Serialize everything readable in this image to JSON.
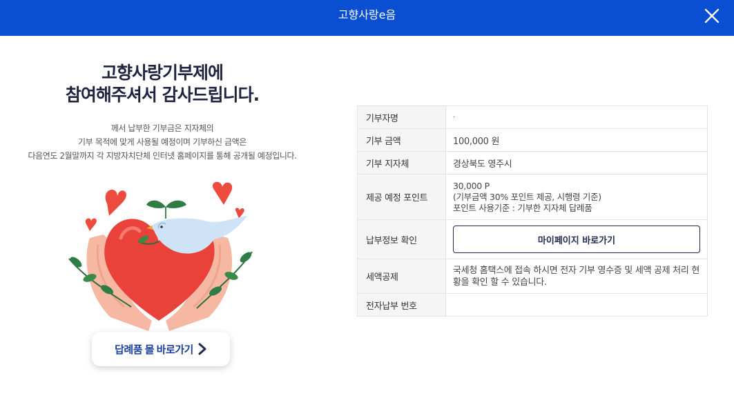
{
  "header": {
    "title": "고향사랑e음"
  },
  "heading": {
    "line1": "고향사랑기부제에",
    "line2": "참여해주셔서 감사드립니다."
  },
  "description": {
    "line1": "께서 납부한 기부금은 지자체의",
    "line2": "기부 목적에 맞게 사용될 예정이며 기부하신 금액은",
    "line3": "다음연도 2월말까지 각 지방자치단체 인터넷 홈페이지를 통해 공개될 예정입니다."
  },
  "mall_button": {
    "label": "답례품 몰 바로가기"
  },
  "details": {
    "donor_label": "기부자명",
    "donor_value": "·",
    "amount_label": "기부 금액",
    "amount_value": "100,000 원",
    "region_label": "기부 지자체",
    "region_value": "경상북도 영주시",
    "points_label": "제공 예정 포인트",
    "points_line1": "30,000 P",
    "points_line2": "(기부금액 30% 포인트 제공, 시행령 기준)",
    "points_line3": "포인트 사용기준 : 기부한 지자체 답례품",
    "payment_label": "납부정보 확인",
    "mypage_button": "마이페이지 바로가기",
    "tax_label": "세액공제",
    "tax_value": "국세청 홈택스에 접속 하시면 전자 기부 영수증 및 세액 공제 처리 현황을 확인 할 수 있습니다.",
    "epay_label": "전자납부 번호",
    "epay_value": ""
  },
  "colors": {
    "header": "#0a4fd1",
    "heading": "#1f2340",
    "button_text": "#1a3fa0"
  },
  "icons": {
    "close": "close-icon",
    "chevron": "chevron-right-icon"
  }
}
